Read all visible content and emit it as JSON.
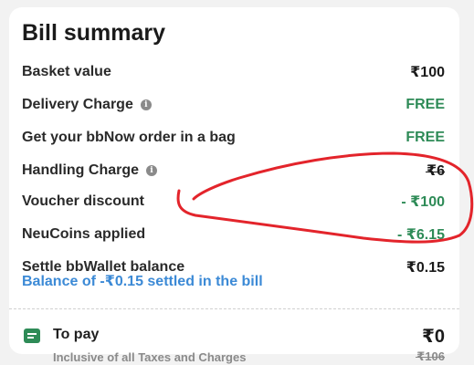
{
  "bill": {
    "title": "Bill summary",
    "rows": [
      {
        "label": "Basket value",
        "value": "₹100"
      },
      {
        "label": "Delivery Charge",
        "value": "FREE"
      },
      {
        "label": "Get your bbNow order in a bag",
        "value": "FREE"
      },
      {
        "label": "Handling Charge",
        "value": "₹6"
      },
      {
        "label": "Voucher discount",
        "value": "- ₹100"
      },
      {
        "label": "NeuCoins applied",
        "value": "- ₹6.15"
      },
      {
        "label": "Settle bbWallet balance",
        "value": "₹0.15"
      }
    ],
    "wallet_note": "Balance of -₹0.15 settled in the bill"
  },
  "to_pay": {
    "label": "To pay",
    "subtext": "Inclusive of all Taxes and Charges",
    "amount": "₹0",
    "original_amount": "₹106"
  },
  "icons": {
    "info": "info-icon",
    "to_pay": "receipt-icon"
  },
  "colors": {
    "green": "#2e8b57",
    "link_blue": "#3c8ad6",
    "annotation_red": "#e3242b"
  }
}
